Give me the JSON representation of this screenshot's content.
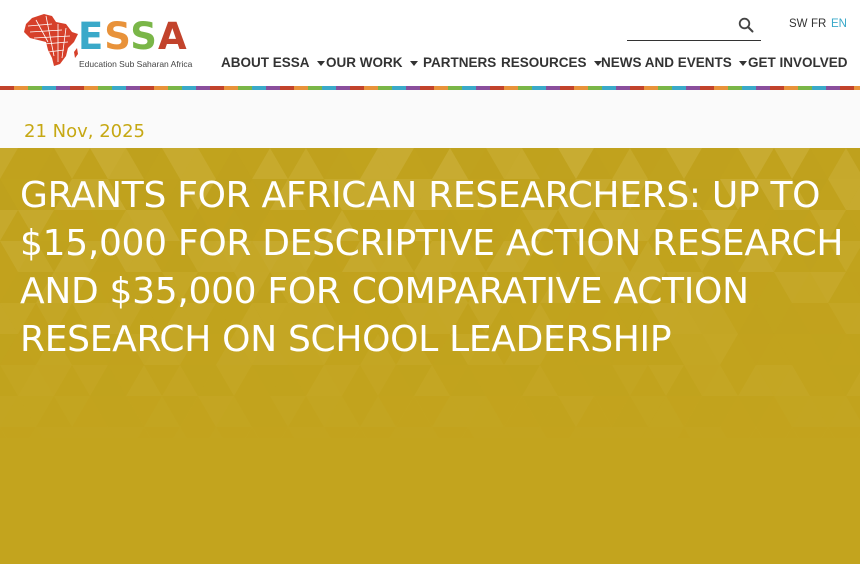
{
  "brand": {
    "name": "ESSA",
    "tagline": "Education Sub Saharan Africa",
    "colors": {
      "e": "#3aa9c9",
      "s1": "#e8923a",
      "s2": "#7ab648",
      "a": "#c2432c",
      "map": "#d6402a"
    }
  },
  "search": {
    "placeholder": "",
    "icon": "search-icon"
  },
  "languages": [
    {
      "code": "SW",
      "active": false
    },
    {
      "code": "FR",
      "active": false
    },
    {
      "code": "EN",
      "active": true
    }
  ],
  "nav": [
    {
      "label": "ABOUT ESSA",
      "dropdown": true
    },
    {
      "label": "OUR WORK",
      "dropdown": true
    },
    {
      "label": "PARTNERS",
      "dropdown": false
    },
    {
      "label": "RESOURCES",
      "dropdown": true
    },
    {
      "label": "NEWS AND EVENTS",
      "dropdown": true
    },
    {
      "label": "GET INVOLVED",
      "dropdown": false
    }
  ],
  "article": {
    "date": "21 Nov, 2025",
    "title": " GRANTS FOR AFRICAN RESEARCHERS: UP TO $15,000 FOR DESCRIPTIVE ACTION RESEARCH AND $35,000 FOR COMPARATIVE ACTION RESEARCH ON SCHOOL LEADERSHIP"
  },
  "colors": {
    "hero": "#c3a41e",
    "date": "#c6a813",
    "accent": "#3aa9c9"
  }
}
